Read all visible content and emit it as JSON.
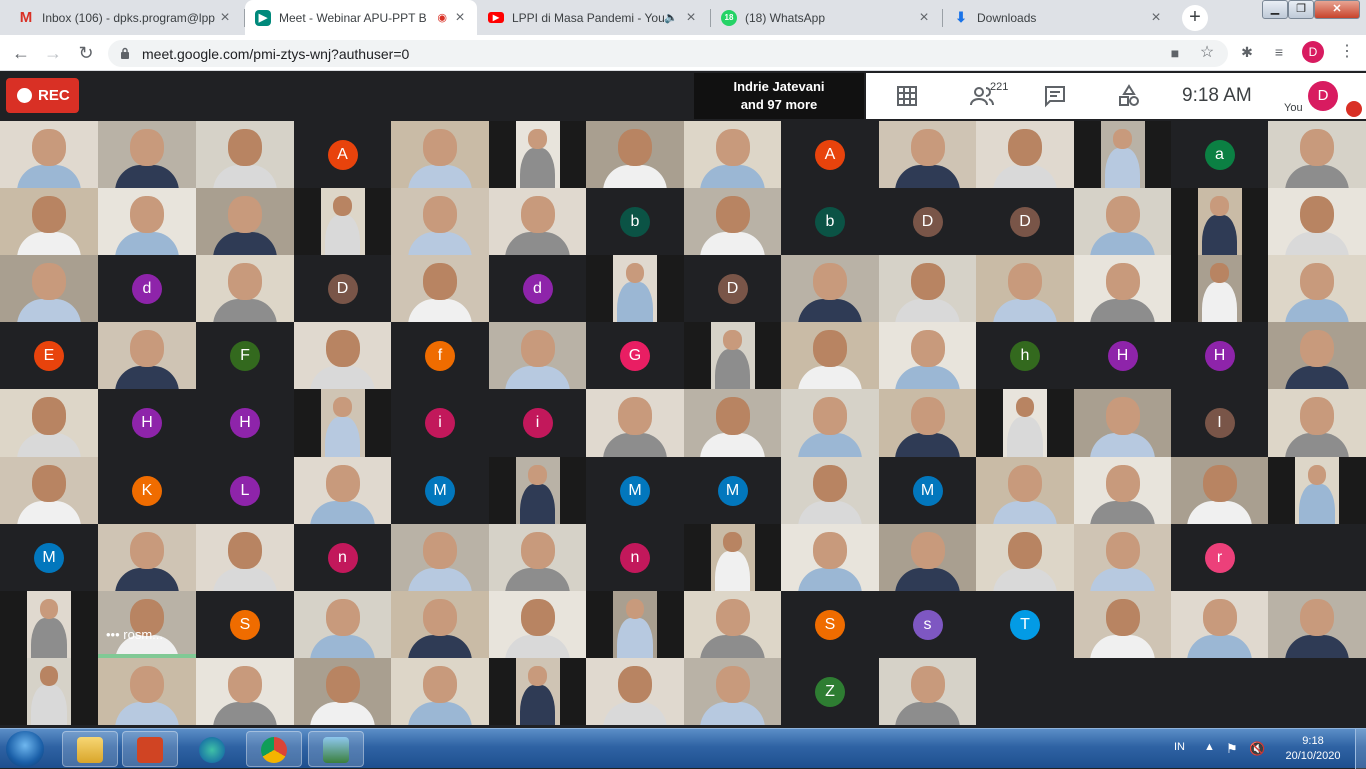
{
  "browser": {
    "tabs": [
      {
        "title": "Inbox (106) - dpks.program@lpp",
        "icon": "gmail-icon"
      },
      {
        "title": "Meet - Webinar APU-PPT B",
        "icon": "meet-icon",
        "active": true
      },
      {
        "title": "LPPI di Masa Pandemi - You",
        "icon": "youtube-icon"
      },
      {
        "title": "(18) WhatsApp",
        "icon": "whatsapp-icon",
        "badge": "18"
      },
      {
        "title": "Downloads",
        "icon": "download-icon"
      }
    ],
    "url": "meet.google.com/pmi-ztys-wnj?authuser=0",
    "profile_initial": "D"
  },
  "meet": {
    "rec_label": "REC",
    "presenting_line1": "Indrie Jatevani",
    "presenting_line2": "and 97 more",
    "participant_count": "221",
    "clock": "9:18  AM",
    "you_label": "You",
    "my_initial": "D",
    "tiles": [
      [
        "v",
        "v",
        "v",
        "A",
        "v",
        "v",
        "v",
        "v",
        "A",
        "v",
        "v",
        "v",
        "a",
        "v"
      ],
      [
        "v",
        "v",
        "v",
        "v",
        "v",
        "v",
        "b",
        "v",
        "b",
        "D",
        "D",
        "v",
        "v",
        "v"
      ],
      [
        "v",
        "d",
        "v",
        "D",
        "v",
        "d",
        "v",
        "D",
        "v",
        "v",
        "v",
        "v",
        "v",
        "v"
      ],
      [
        "E",
        "v",
        "F",
        "v",
        "f",
        "v",
        "G",
        "v",
        "v",
        "v",
        "h",
        "H",
        "H",
        "v"
      ],
      [
        "v",
        "H",
        "H",
        "v",
        "i",
        "i",
        "v",
        "v",
        "v",
        "v",
        "v",
        "v",
        "I",
        "v"
      ],
      [
        "v",
        "K",
        "L",
        "v",
        "M",
        "v",
        "M",
        "M",
        "v",
        "M",
        "v",
        "v",
        "v",
        "v"
      ],
      [
        "M",
        "v",
        "v",
        "n",
        "v",
        "v",
        "n",
        "v",
        "v",
        "v",
        "v",
        "v",
        "r",
        ""
      ],
      [
        "v",
        "v",
        "S",
        "v",
        "v",
        "v",
        "v",
        "v",
        "S",
        "s",
        "T",
        "v",
        "v",
        "v"
      ],
      [
        "v",
        "v",
        "v",
        "v",
        "v",
        "v",
        "v",
        "v",
        "Z",
        "v",
        "",
        "",
        "",
        ""
      ]
    ],
    "name_label": "rosm..."
  },
  "taskbar": {
    "lang": "IN",
    "time": "9:18",
    "date": "20/10/2020"
  }
}
